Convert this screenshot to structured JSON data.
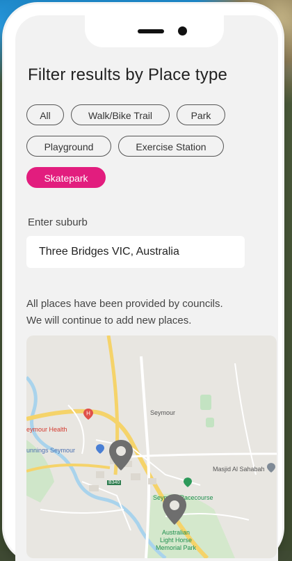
{
  "header": {
    "title": "Filter results by Place type"
  },
  "filters": {
    "chips": [
      {
        "label": "All",
        "active": false
      },
      {
        "label": "Walk/Bike Trail",
        "active": false
      },
      {
        "label": "Park",
        "active": false
      },
      {
        "label": "Playground",
        "active": false
      },
      {
        "label": "Exercise Station",
        "active": false
      },
      {
        "label": "Skatepark",
        "active": true
      }
    ],
    "accent_color": "#e21d7e"
  },
  "suburb": {
    "label": "Enter suburb",
    "value": "Three Bridges VIC, Australia"
  },
  "note": {
    "line1": "All places have been provided by councils.",
    "line2": "We will continue to add new places."
  },
  "map": {
    "labels": {
      "hospital": "eymour Health",
      "town": "Seymour",
      "bunnings": "unnings Seymour",
      "mosque": "Masjid Al Sahabah",
      "racecourse": "Seymour Racecourse",
      "memorial_1": "Australian",
      "memorial_2": "Light Horse",
      "memorial_3": "Memorial Park",
      "road_shield": "B340"
    },
    "pin_color": "#6e6e6e"
  }
}
